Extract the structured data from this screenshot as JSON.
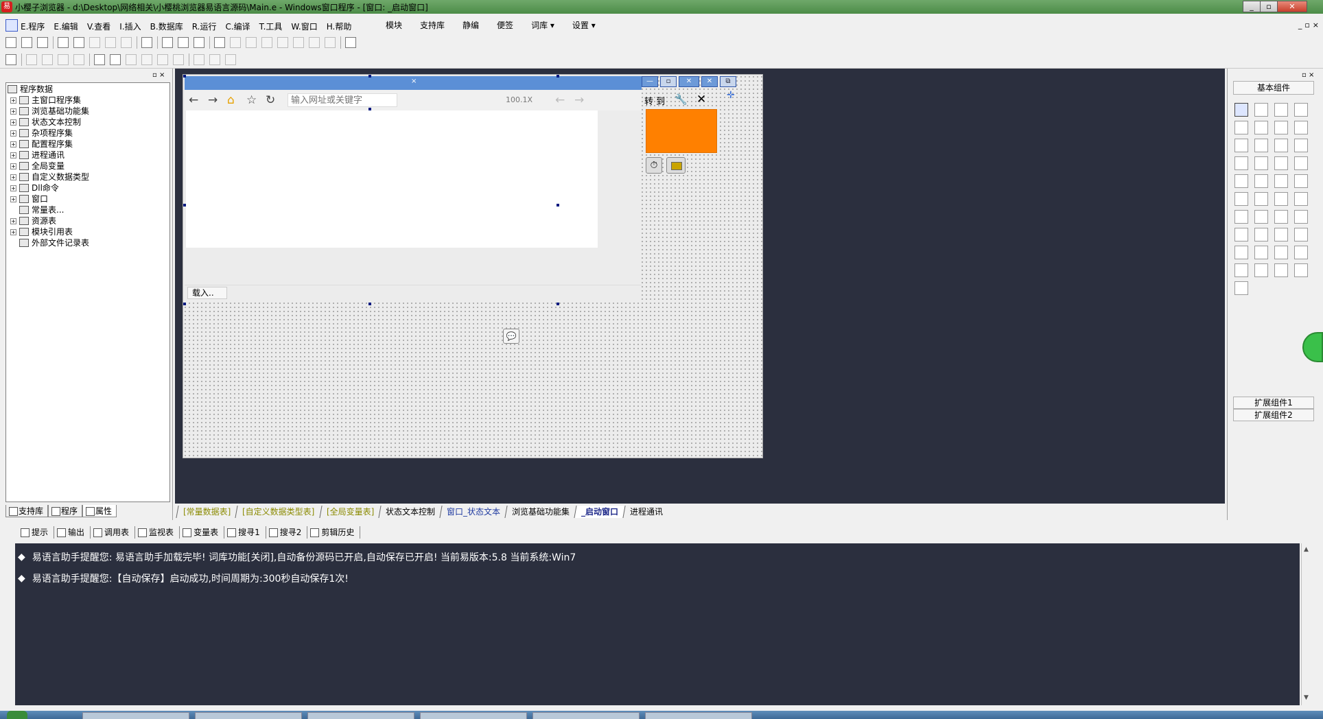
{
  "title_bar": {
    "title": "小樱子浏览器 - d:\\Desktop\\网络相关\\小樱桃浏览器易语言源码\\Main.e - Windows窗口程序 - [窗口: _启动窗口]"
  },
  "menu": {
    "items": [
      "E.程序",
      "E.编辑",
      "V.查看",
      "I.插入",
      "B.数据库",
      "R.运行",
      "C.编译",
      "T.工具",
      "W.窗口",
      "H.帮助"
    ],
    "extras": [
      "模块",
      "支持库",
      "静编",
      "便签",
      "词库 ▾",
      "设置 ▾"
    ],
    "mdi_buttons": [
      "_",
      "▫",
      "×"
    ]
  },
  "tree": {
    "root": "程序数据",
    "items": [
      "主窗口程序集",
      "浏览基础功能集",
      "状态文本控制",
      "杂项程序集",
      "配置程序集",
      "进程通讯",
      "全局变量",
      "自定义数据类型",
      "Dll命令",
      "窗口",
      "常量表...",
      "资源表",
      "模块引用表",
      "外部文件记录表"
    ]
  },
  "left_tabs": [
    "支持库",
    "程序",
    "属性"
  ],
  "form": {
    "url_placeholder": "输入网址或关键字",
    "zoom_text": "100.1X",
    "goto_label": "转 到",
    "status_text": "载入..",
    "nav_icons": [
      "back-arrow-icon",
      "forward-arrow-icon",
      "home-icon",
      "star-icon",
      "refresh-icon"
    ],
    "accent_color": "#ff8000",
    "titlebar_color": "#5b8fd6"
  },
  "right_panel": {
    "header": "基本组件",
    "extra1": "扩展组件1",
    "extra2": "扩展组件2"
  },
  "editor_tabs": [
    {
      "label": "[常量数据表]",
      "style": "yellow"
    },
    {
      "label": "[自定义数据类型表]",
      "style": "yellow"
    },
    {
      "label": "[全局变量表]",
      "style": "yellow"
    },
    {
      "label": "状态文本控制",
      "style": "normal"
    },
    {
      "label": "窗口_状态文本",
      "style": "blue"
    },
    {
      "label": "浏览基础功能集",
      "style": "normal"
    },
    {
      "label": "_启动窗口",
      "style": "active"
    },
    {
      "label": "进程通讯",
      "style": "normal"
    }
  ],
  "output_tabs": [
    "提示",
    "输出",
    "调用表",
    "监视表",
    "变量表",
    "搜寻1",
    "搜寻2",
    "剪辑历史"
  ],
  "output_lines": [
    "易语言助手提醒您:  易语言助手加载完毕!  词库功能[关闭],自动备份源码已开启,自动保存已开启!  当前易版本:5.8  当前系统:Win7",
    "易语言助手提醒您:【自动保存】启动成功,时间周期为:300秒自动保存1次!"
  ]
}
